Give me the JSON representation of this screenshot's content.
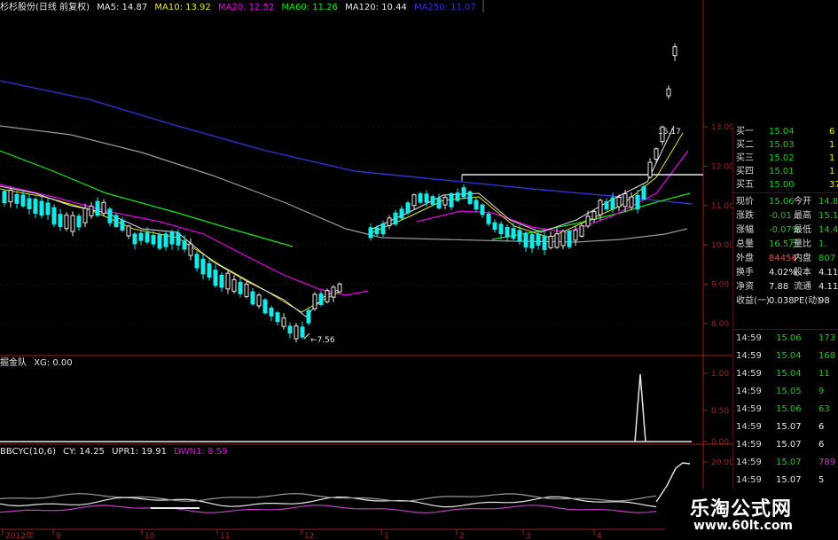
{
  "header": {
    "stock": "杉杉股份(日线 前复权)",
    "ma5": "MA5: 14.87",
    "ma10": "MA10: 13.92",
    "ma20": "MA20: 12.52",
    "ma60": "MA60: 11.26",
    "ma120": "MA120: 10.44",
    "ma250": "MA250: 11.07"
  },
  "ind1_header": {
    "name": "掘金队",
    "xg": "XG: 0.00"
  },
  "ind2_header": {
    "name": "BBCYC(10,6)",
    "cy": "CY: 14.25",
    "upr": "UPR1: 19.91",
    "dwn": "DWN1: 8.59"
  },
  "price_axis": [
    "13.00",
    "12.00",
    "11.00",
    "10.00",
    "9.00",
    "8.00"
  ],
  "ind1_axis": [
    "1.00",
    "0.50",
    "0.00"
  ],
  "ind2_axis": [
    "20.00"
  ],
  "low_label": "7.56",
  "high_label": "15.17",
  "bottom_axis": [
    "2012年",
    "9",
    "10",
    "11",
    "12",
    "1",
    "2",
    "3",
    "4",
    "5"
  ],
  "quote": {
    "bids": [
      {
        "label": "买一",
        "price": "15.04",
        "vol": "6"
      },
      {
        "label": "买二",
        "price": "15.03",
        "vol": "1"
      },
      {
        "label": "买三",
        "price": "15.02",
        "vol": "1"
      },
      {
        "label": "买四",
        "price": "15.01",
        "vol": "1"
      },
      {
        "label": "买五",
        "price": "15.00",
        "vol": "37"
      }
    ],
    "stats": [
      {
        "l1": "现价",
        "v1": "15.06",
        "l2": "今开",
        "v2": "14.8"
      },
      {
        "l1": "涨跌",
        "v1": "-0.01",
        "l2": "最高",
        "v2": "15.1"
      },
      {
        "l1": "涨幅",
        "v1": "-0.07%",
        "l2": "最低",
        "v2": "14.4"
      },
      {
        "l1": "总量",
        "v1": "16.5万",
        "l2": "量比",
        "v2": "1."
      },
      {
        "l1": "外盘",
        "v1": "84456",
        "l2": "内盘",
        "v2": "807"
      },
      {
        "l1": "换手",
        "v1": "4.02%",
        "l2": "股本",
        "v2": "4.11"
      },
      {
        "l1": "净资",
        "v1": "7.88",
        "l2": "流通",
        "v2": "4.11"
      },
      {
        "l1": "收益(一)",
        "v1": "0.038",
        "l2": "PE(动)",
        "v2": "98"
      }
    ],
    "ticks": [
      {
        "time": "14:59",
        "price": "15.06",
        "vol": "173",
        "color": "#18c818"
      },
      {
        "time": "14:59",
        "price": "15.04",
        "vol": "168",
        "color": "#18c818"
      },
      {
        "time": "14:59",
        "price": "15.04",
        "vol": "11",
        "color": "#18c818"
      },
      {
        "time": "14:59",
        "price": "15.05",
        "vol": "9",
        "color": "#18c818"
      },
      {
        "time": "14:59",
        "price": "15.06",
        "vol": "63",
        "color": "#18c818"
      },
      {
        "time": "14:59",
        "price": "15.07",
        "vol": "6",
        "color": "#e8e8e8"
      },
      {
        "time": "14:59",
        "price": "15.07",
        "vol": "6",
        "color": "#e8e8e8"
      },
      {
        "time": "14:59",
        "price": "15.07",
        "vol": "789",
        "color": "#c040c0"
      },
      {
        "time": "14:59",
        "price": "15.07",
        "vol": "5",
        "color": "#e8e8e8"
      },
      {
        "time": "14:59",
        "price": "15.06",
        "vol": "1",
        "color": "#e8e8e8"
      },
      {
        "time": "14:59",
        "price": "15.06",
        "vol": "1",
        "color": "#e8e8e8"
      }
    ]
  },
  "watermark": {
    "title": "乐淘公式网",
    "url": "www.60lt.com"
  },
  "colors": {
    "ma5": "#e8e8e8",
    "ma10": "#e8e800",
    "ma20": "#e800e8",
    "ma60": "#18e818",
    "ma120": "#9a9a9a",
    "ma250": "#3030d0",
    "up": "#e8e8e8",
    "down": "#18e8e8",
    "axis": "#a02020"
  },
  "chart_data": [
    {
      "type": "line",
      "title": "杉杉股份(日线 前复权)",
      "ylim": [
        7.5,
        13.2
      ],
      "x": [
        "2012年",
        "9",
        "10",
        "11",
        "12",
        "1",
        "2",
        "3",
        "4",
        "5"
      ],
      "series": [
        {
          "name": "MA250",
          "values": [
            12.5,
            12.35,
            12.2,
            12.05,
            11.9,
            11.7,
            11.55,
            11.45,
            11.3,
            11.07
          ]
        },
        {
          "name": "MA120",
          "values": [
            11.6,
            11.35,
            11.05,
            10.75,
            10.35,
            10.0,
            10.0,
            10.0,
            10.05,
            10.44
          ]
        },
        {
          "name": "MA60",
          "values": [
            11.2,
            10.9,
            10.6,
            10.3,
            10.0,
            10.0,
            10.6,
            10.8,
            10.95,
            11.26
          ]
        },
        {
          "name": "MA20",
          "values": [
            11.05,
            10.7,
            10.2,
            9.4,
            8.7,
            10.1,
            10.9,
            10.5,
            10.6,
            12.52
          ]
        }
      ],
      "annotations": [
        "7.56",
        "15.17"
      ]
    },
    {
      "type": "line",
      "title": "掘金队",
      "ylim": [
        0,
        1
      ],
      "x": [
        "2012年",
        "9",
        "10",
        "11",
        "12",
        "1",
        "2",
        "3",
        "4",
        "5"
      ],
      "series": [
        {
          "name": "XG",
          "values": [
            0,
            0,
            0,
            0,
            0,
            0,
            0,
            0,
            1,
            0
          ]
        }
      ]
    },
    {
      "type": "line",
      "title": "BBCYC(10,6)",
      "x": [
        "2012年",
        "9",
        "10",
        "11",
        "12",
        "1",
        "2",
        "3",
        "4",
        "5"
      ],
      "series": [
        {
          "name": "CY",
          "values": [
            9.5,
            9.2,
            9.6,
            8.9,
            9.3,
            9.8,
            9.6,
            9.9,
            10.1,
            14.25
          ]
        },
        {
          "name": "UPR1",
          "values": [
            10.4,
            10.2,
            10.5,
            10.1,
            10.3,
            10.7,
            10.5,
            10.8,
            11.0,
            19.91
          ]
        },
        {
          "name": "DWN1",
          "values": [
            8.4,
            8.2,
            8.6,
            7.9,
            8.2,
            8.5,
            8.3,
            8.6,
            8.8,
            8.59
          ]
        }
      ]
    }
  ]
}
